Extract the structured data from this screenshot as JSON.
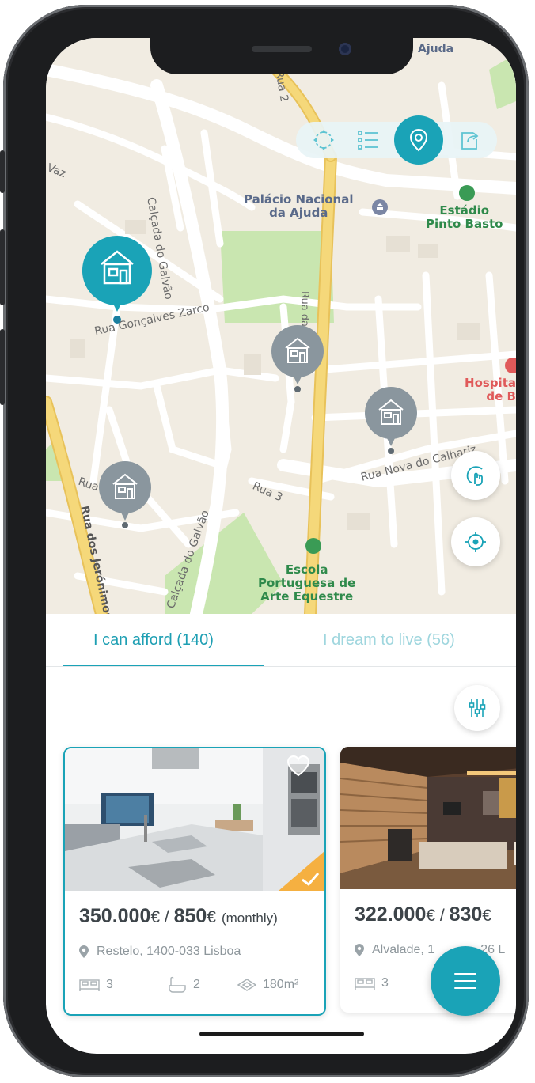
{
  "map": {
    "streets": {
      "rua_2": "Rua 2",
      "vaz": "do Vaz",
      "calcada_galvao": "Calçada do Galvão",
      "goncalves_zarco": "Rua Gonçalves Zarco",
      "rua_3": "Rua 3",
      "rua_20": "Rua 20",
      "jeronimos": "Rua dos Jerónimos",
      "calcada_galvao_2": "Calçada do Galvão",
      "nova_calhariz": "Rua Nova do Calhariz",
      "merces": "Rua das Mercês",
      "top_partial": "Ajuda"
    },
    "pois": {
      "palacio_line1": "Palácio Nacional",
      "palacio_line2": "da Ajuda",
      "estadio_line1": "Estádio",
      "estadio_line2": "Pinto Basto",
      "escola_line1": "Escola",
      "escola_line2": "Portuguesa de",
      "escola_line3": "Arte Equestre",
      "hospital_line1": "Hospita",
      "hospital_line2": "de B"
    },
    "toolbar": {
      "icons": [
        "fit-bounds-icon",
        "list-icon",
        "map-pin-icon",
        "share-icon"
      ],
      "active": "map-pin-icon"
    },
    "markers": {
      "selected_color": "#1aa3b7",
      "default_color": "#8a969e",
      "count": 4
    }
  },
  "tabs": {
    "afford": "I can afford (140)",
    "dream": "I dream to live (56)",
    "active": "afford"
  },
  "cards": [
    {
      "price": "350.000",
      "currency": "€",
      "separator": " / ",
      "rent": "850",
      "rent_suffix": "(monthly)",
      "location": "Restelo, 1400-033 Lisboa",
      "bedrooms": "3",
      "bathrooms": "2",
      "area": "180m²",
      "selected": true,
      "favorite": true
    },
    {
      "price": "322.000",
      "currency": "€",
      "separator": " / ",
      "rent": "830",
      "location_left": "Alvalade, 1",
      "location_right": "26 L",
      "bedrooms": "3",
      "selected": false
    }
  ],
  "colors": {
    "accent": "#1aa3b7",
    "tab_inactive": "#9fd6de",
    "text_dark": "#3d4449",
    "text_muted": "#8d969b",
    "map_bg": "#f1ece2",
    "road_major": "#f5d87a",
    "park": "#c9e6b0",
    "selected_check": "#f5b041"
  }
}
